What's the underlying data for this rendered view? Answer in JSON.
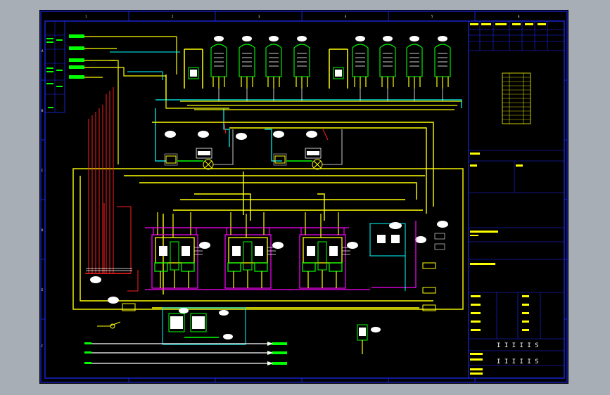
{
  "colors": {
    "frame": "#1e2bff",
    "yellow": "#ffff00",
    "cyan": "#00ffff",
    "red": "#ff2020",
    "magenta": "#ff00ff",
    "green": "#00ff00",
    "white": "#ffffff",
    "outer_bg": "#a7aeb6"
  },
  "border": {
    "top_numbers": [
      "1",
      "2",
      "3",
      "4",
      "5",
      "6",
      "7",
      "8"
    ],
    "side_letters": [
      "A",
      "B",
      "C",
      "D",
      "E",
      "F"
    ]
  },
  "drawing": {
    "tank_count_top": 9,
    "boiler_count": 3,
    "bottom_outlet_lines": 3
  },
  "title_block": {
    "sign_rows": 5,
    "footer_text": "I I I I I S"
  }
}
